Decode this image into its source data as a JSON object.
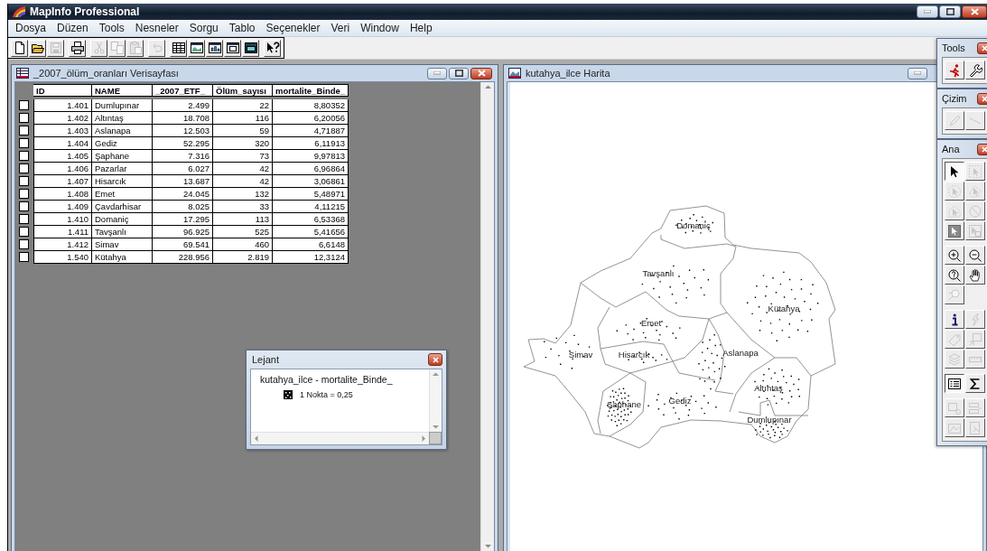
{
  "window": {
    "title": "MapInfo Professional"
  },
  "menu": [
    "Dosya",
    "Düzen",
    "Tools",
    "Nesneler",
    "Sorgu",
    "Tablo",
    "Seçenekler",
    "Veri",
    "Window",
    "Help"
  ],
  "toolbar": [
    [
      {
        "kind": "new",
        "disabled": false
      },
      {
        "kind": "open",
        "disabled": false
      },
      {
        "kind": "save",
        "disabled": true
      }
    ],
    [
      {
        "kind": "print",
        "disabled": false
      }
    ],
    [
      {
        "kind": "cut",
        "disabled": true
      },
      {
        "kind": "copy",
        "disabled": true
      },
      {
        "kind": "paste",
        "disabled": true
      }
    ],
    [
      {
        "kind": "undo",
        "disabled": true
      }
    ],
    [
      {
        "kind": "browser",
        "disabled": false
      },
      {
        "kind": "map",
        "disabled": false
      },
      {
        "kind": "graph",
        "disabled": false
      },
      {
        "kind": "layout",
        "disabled": false
      },
      {
        "kind": "redistrict",
        "disabled": false
      }
    ],
    [
      {
        "kind": "help",
        "disabled": false
      }
    ]
  ],
  "table_window": {
    "title": "_2007_ölüm_oranları Verisayfası",
    "columns": [
      "ID",
      "NAME",
      "_2007_ETF_",
      "Ölüm_sayısı",
      "mortalite_Binde_"
    ],
    "rows": [
      {
        "checked": false,
        "cells": [
          "1.401",
          "Dumlupınar",
          "2.499",
          "22",
          "8,80352"
        ]
      },
      {
        "checked": false,
        "cells": [
          "1.402",
          "Altıntaş",
          "18.708",
          "116",
          "6,20056"
        ]
      },
      {
        "checked": false,
        "cells": [
          "1.403",
          "Aslanapa",
          "12.503",
          "59",
          "4,71887"
        ]
      },
      {
        "checked": false,
        "cells": [
          "1.404",
          "Gediz",
          "52.295",
          "320",
          "6,11913"
        ]
      },
      {
        "checked": false,
        "cells": [
          "1.405",
          "Şaphane",
          "7.316",
          "73",
          "9,97813"
        ]
      },
      {
        "checked": false,
        "cells": [
          "1.406",
          "Pazarlar",
          "6.027",
          "42",
          "6,96864"
        ]
      },
      {
        "checked": false,
        "cells": [
          "1.407",
          "Hisarcık",
          "13.687",
          "42",
          "3,06861"
        ]
      },
      {
        "checked": false,
        "cells": [
          "1.408",
          "Emet",
          "24.045",
          "132",
          "5,48971"
        ]
      },
      {
        "checked": false,
        "cells": [
          "1.409",
          "Çavdarhisar",
          "8.025",
          "33",
          "4,11215"
        ]
      },
      {
        "checked": false,
        "cells": [
          "1.410",
          "Domaniç",
          "17.295",
          "113",
          "6,53368"
        ]
      },
      {
        "checked": false,
        "cells": [
          "1.411",
          "Tavşanlı",
          "96.925",
          "525",
          "5,41656"
        ]
      },
      {
        "checked": false,
        "cells": [
          "1.412",
          "Simav",
          "69.541",
          "460",
          "6,6148"
        ]
      },
      {
        "checked": false,
        "cells": [
          "1.540",
          "Kütahya",
          "228.956",
          "2.819",
          "12,3124"
        ]
      }
    ]
  },
  "map_window": {
    "title": "kutahya_ilce Harita",
    "labels": [
      "Domaniç",
      "Tavşanlı",
      "Kütahya",
      "Emet",
      "Simav",
      "Hisarcık",
      "Aslanapa",
      "Altıntaş",
      "Şaphane",
      "Gediz",
      "Dumlupınar"
    ]
  },
  "legend": {
    "title": "Lejant",
    "layer": "kutahya_ilce - mortalite_Binde_",
    "entry": "1 Nokta = 0,25"
  },
  "palettes": [
    {
      "title": "Tools",
      "groups": [
        [
          {
            "kind": "run",
            "selected": false,
            "disabled": false
          },
          {
            "kind": "wrench",
            "selected": false,
            "disabled": false
          }
        ]
      ]
    },
    {
      "title": "Çizim",
      "groups": [
        [
          {
            "kind": "pen",
            "selected": false,
            "disabled": true
          },
          {
            "kind": "line",
            "selected": false,
            "disabled": true
          }
        ]
      ]
    },
    {
      "title": "Ana",
      "groups": [
        [
          {
            "kind": "pointer",
            "selected": true,
            "disabled": false
          },
          {
            "kind": "marquee",
            "selected": false,
            "disabled": true
          },
          {
            "kind": "radius",
            "selected": false,
            "disabled": true
          },
          {
            "kind": "polygon",
            "selected": false,
            "disabled": true
          },
          {
            "kind": "boundary",
            "selected": false,
            "disabled": true
          },
          {
            "kind": "invert",
            "selected": false,
            "disabled": true
          },
          {
            "kind": "selectall",
            "selected": false,
            "disabled": false
          },
          {
            "kind": "graphsel",
            "selected": false,
            "disabled": true
          }
        ],
        [
          {
            "kind": "zoomin",
            "selected": false,
            "disabled": false
          },
          {
            "kind": "zoomout",
            "selected": false,
            "disabled": false
          },
          {
            "kind": "zoomquery",
            "selected": false,
            "disabled": false
          },
          {
            "kind": "hand",
            "selected": false,
            "disabled": false
          },
          {
            "kind": "magnifier",
            "selected": false,
            "disabled": true
          }
        ],
        [
          {
            "kind": "info",
            "selected": false,
            "disabled": false
          },
          {
            "kind": "hotlink",
            "selected": false,
            "disabled": true
          },
          {
            "kind": "label",
            "selected": false,
            "disabled": true
          },
          {
            "kind": "drag",
            "selected": false,
            "disabled": true
          },
          {
            "kind": "layers",
            "selected": false,
            "disabled": true
          },
          {
            "kind": "ruler",
            "selected": false,
            "disabled": true
          }
        ],
        [
          {
            "kind": "legend",
            "selected": true,
            "disabled": false
          },
          {
            "kind": "sigma",
            "selected": false,
            "disabled": false
          }
        ],
        [
          {
            "kind": "target",
            "selected": false,
            "disabled": true
          },
          {
            "kind": "split",
            "selected": false,
            "disabled": true
          },
          {
            "kind": "clip",
            "selected": false,
            "disabled": true
          },
          {
            "kind": "erase",
            "selected": false,
            "disabled": true
          }
        ]
      ]
    }
  ]
}
